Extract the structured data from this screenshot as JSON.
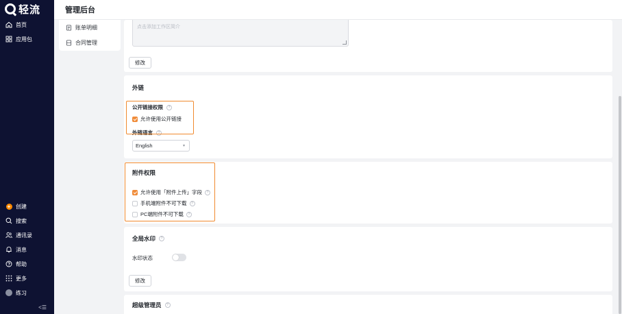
{
  "app": {
    "logo_text": "轻流",
    "header_title": "管理后台"
  },
  "nav": {
    "home": "首页",
    "apps": "应用包",
    "create": "创建",
    "search": "搜索",
    "contacts": "通讯录",
    "messages": "消息",
    "help": "帮助",
    "more": "更多",
    "user": "练习",
    "collapse": "<☰"
  },
  "subside": {
    "bill": "账单明细",
    "contract": "合同管理"
  },
  "workspace": {
    "intro_placeholder": "点击添加工作区简介",
    "edit_label": "修改"
  },
  "external_link": {
    "title": "外链",
    "public_permission_label": "公开链接权限",
    "allow_public_link": "允许使用公开链接",
    "allow_public_link_checked": true,
    "language_label": "外链语言",
    "language_value": "English"
  },
  "attachment": {
    "title": "附件权限",
    "allow_upload_field": "允许使用「附件上传」字段",
    "allow_upload_field_checked": true,
    "mobile_no_download": "手机端附件不可下载",
    "mobile_no_download_checked": false,
    "pc_no_download": "PC端附件不可下载",
    "pc_no_download_checked": false
  },
  "watermark": {
    "title": "全局水印",
    "status_label": "水印状态",
    "status_on": false,
    "edit_label": "修改"
  },
  "super_admin": {
    "title": "超级管理员"
  },
  "colors": {
    "nav_bg": "#0e1232",
    "accent": "#f08c3a",
    "highlight": "#f0892d"
  }
}
